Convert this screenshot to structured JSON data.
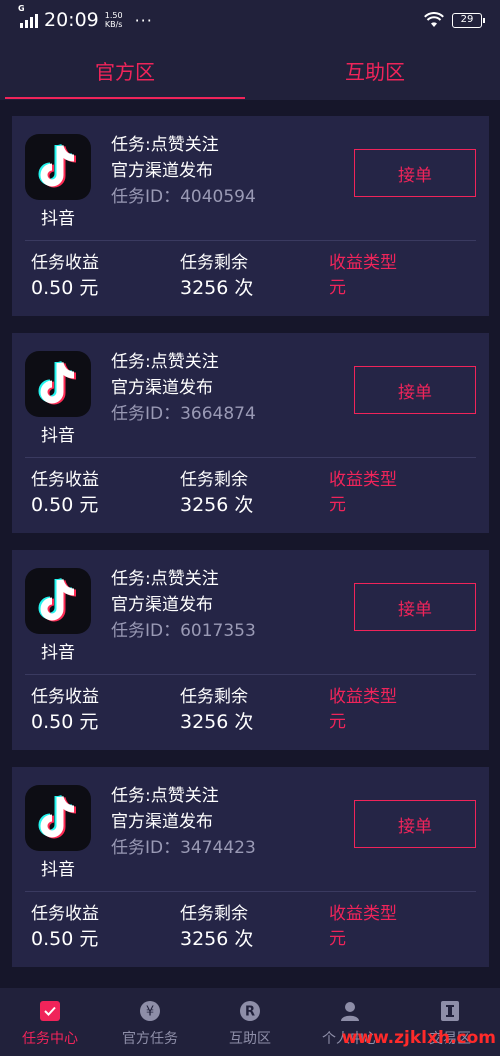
{
  "status_bar": {
    "network": "G",
    "time": "20:09",
    "speed_value": "1.50",
    "speed_unit": "KB/s",
    "more": "···",
    "battery": "29"
  },
  "tabs": [
    {
      "label": "官方区",
      "active": true
    },
    {
      "label": "互助区",
      "active": false
    }
  ],
  "tasks": [
    {
      "app": "抖音",
      "task": "任务:点赞关注",
      "channel": "官方渠道发布",
      "task_id": "任务ID：4040594",
      "button": "接单",
      "income_label": "任务收益",
      "income_value": "0.50 元",
      "remaining_label": "任务剩余",
      "remaining_value": "3256 次",
      "type_label": "收益类型",
      "type_value": "元"
    },
    {
      "app": "抖音",
      "task": "任务:点赞关注",
      "channel": "官方渠道发布",
      "task_id": "任务ID：3664874",
      "button": "接单",
      "income_label": "任务收益",
      "income_value": "0.50 元",
      "remaining_label": "任务剩余",
      "remaining_value": "3256 次",
      "type_label": "收益类型",
      "type_value": "元"
    },
    {
      "app": "抖音",
      "task": "任务:点赞关注",
      "channel": "官方渠道发布",
      "task_id": "任务ID：6017353",
      "button": "接单",
      "income_label": "任务收益",
      "income_value": "0.50 元",
      "remaining_label": "任务剩余",
      "remaining_value": "3256 次",
      "type_label": "收益类型",
      "type_value": "元"
    },
    {
      "app": "抖音",
      "task": "任务:点赞关注",
      "channel": "官方渠道发布",
      "task_id": "任务ID：3474423",
      "button": "接单",
      "income_label": "任务收益",
      "income_value": "0.50 元",
      "remaining_label": "任务剩余",
      "remaining_value": "3256 次",
      "type_label": "收益类型",
      "type_value": "元"
    }
  ],
  "bottom_nav": [
    {
      "label": "任务中心",
      "icon": "task-center-icon",
      "active": true
    },
    {
      "label": "官方任务",
      "icon": "yen-icon",
      "active": false
    },
    {
      "label": "互助区",
      "icon": "r-icon",
      "active": false
    },
    {
      "label": "个人中心",
      "icon": "person-icon",
      "active": false
    },
    {
      "label": "交易区",
      "icon": "trade-icon",
      "active": false
    }
  ],
  "watermark": "www.zjklxh.com",
  "colors": {
    "accent": "#f0245a",
    "background": "#16162a",
    "card": "#252546",
    "bar": "#21213b"
  }
}
